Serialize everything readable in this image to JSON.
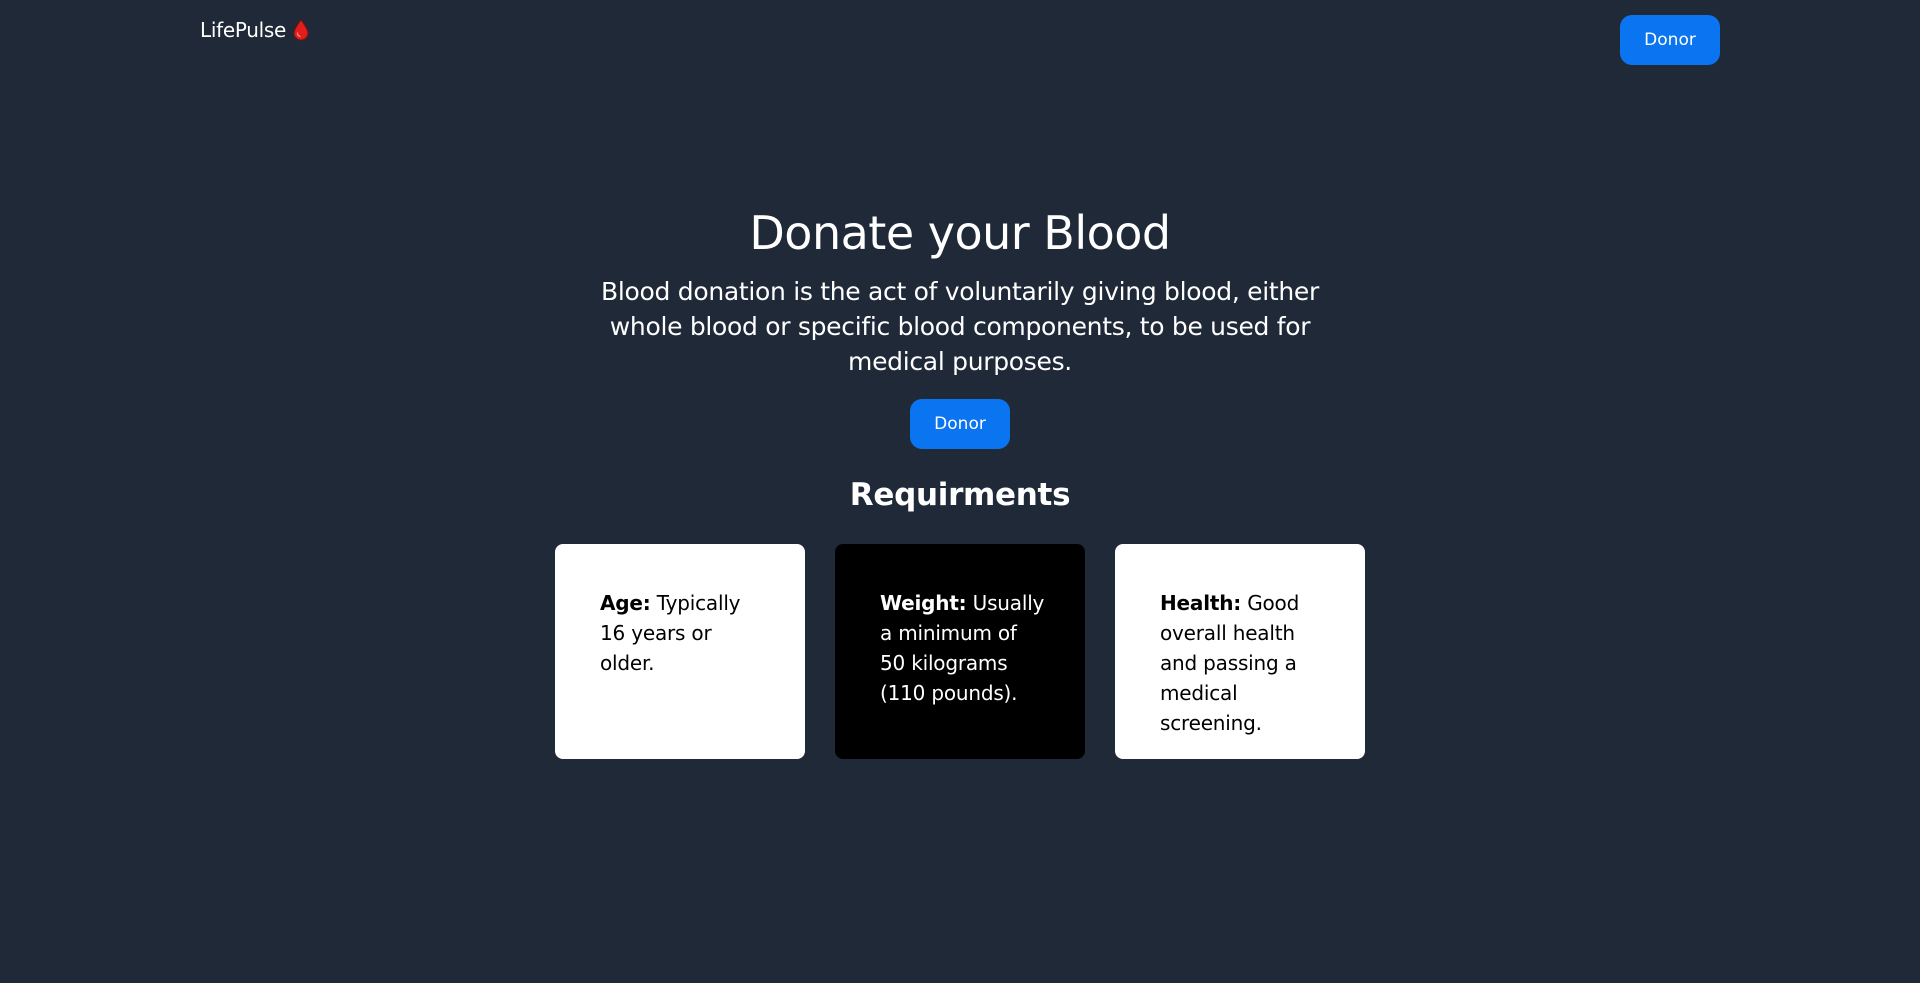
{
  "navbar": {
    "brand": "LifePulse",
    "brand_icon": "blood-drop-icon",
    "donor_label": "Donor"
  },
  "hero": {
    "title": "Donate your Blood",
    "description": "Blood donation is the act of voluntarily giving blood, either whole blood or specific blood components, to be used for medical purposes.",
    "donor_label": "Donor"
  },
  "requirements": {
    "title": "Requirments",
    "cards": [
      {
        "label": "Age:",
        "text": " Typically 16 years or older."
      },
      {
        "label": "Weight:",
        "text": " Usually a minimum of 50 kilograms (110 pounds)."
      },
      {
        "label": "Health:",
        "text": " Good overall health and passing a medical screening."
      }
    ]
  },
  "colors": {
    "background": "#1f2937",
    "accent": "#0b74f1",
    "drop": "#e11d1d"
  }
}
